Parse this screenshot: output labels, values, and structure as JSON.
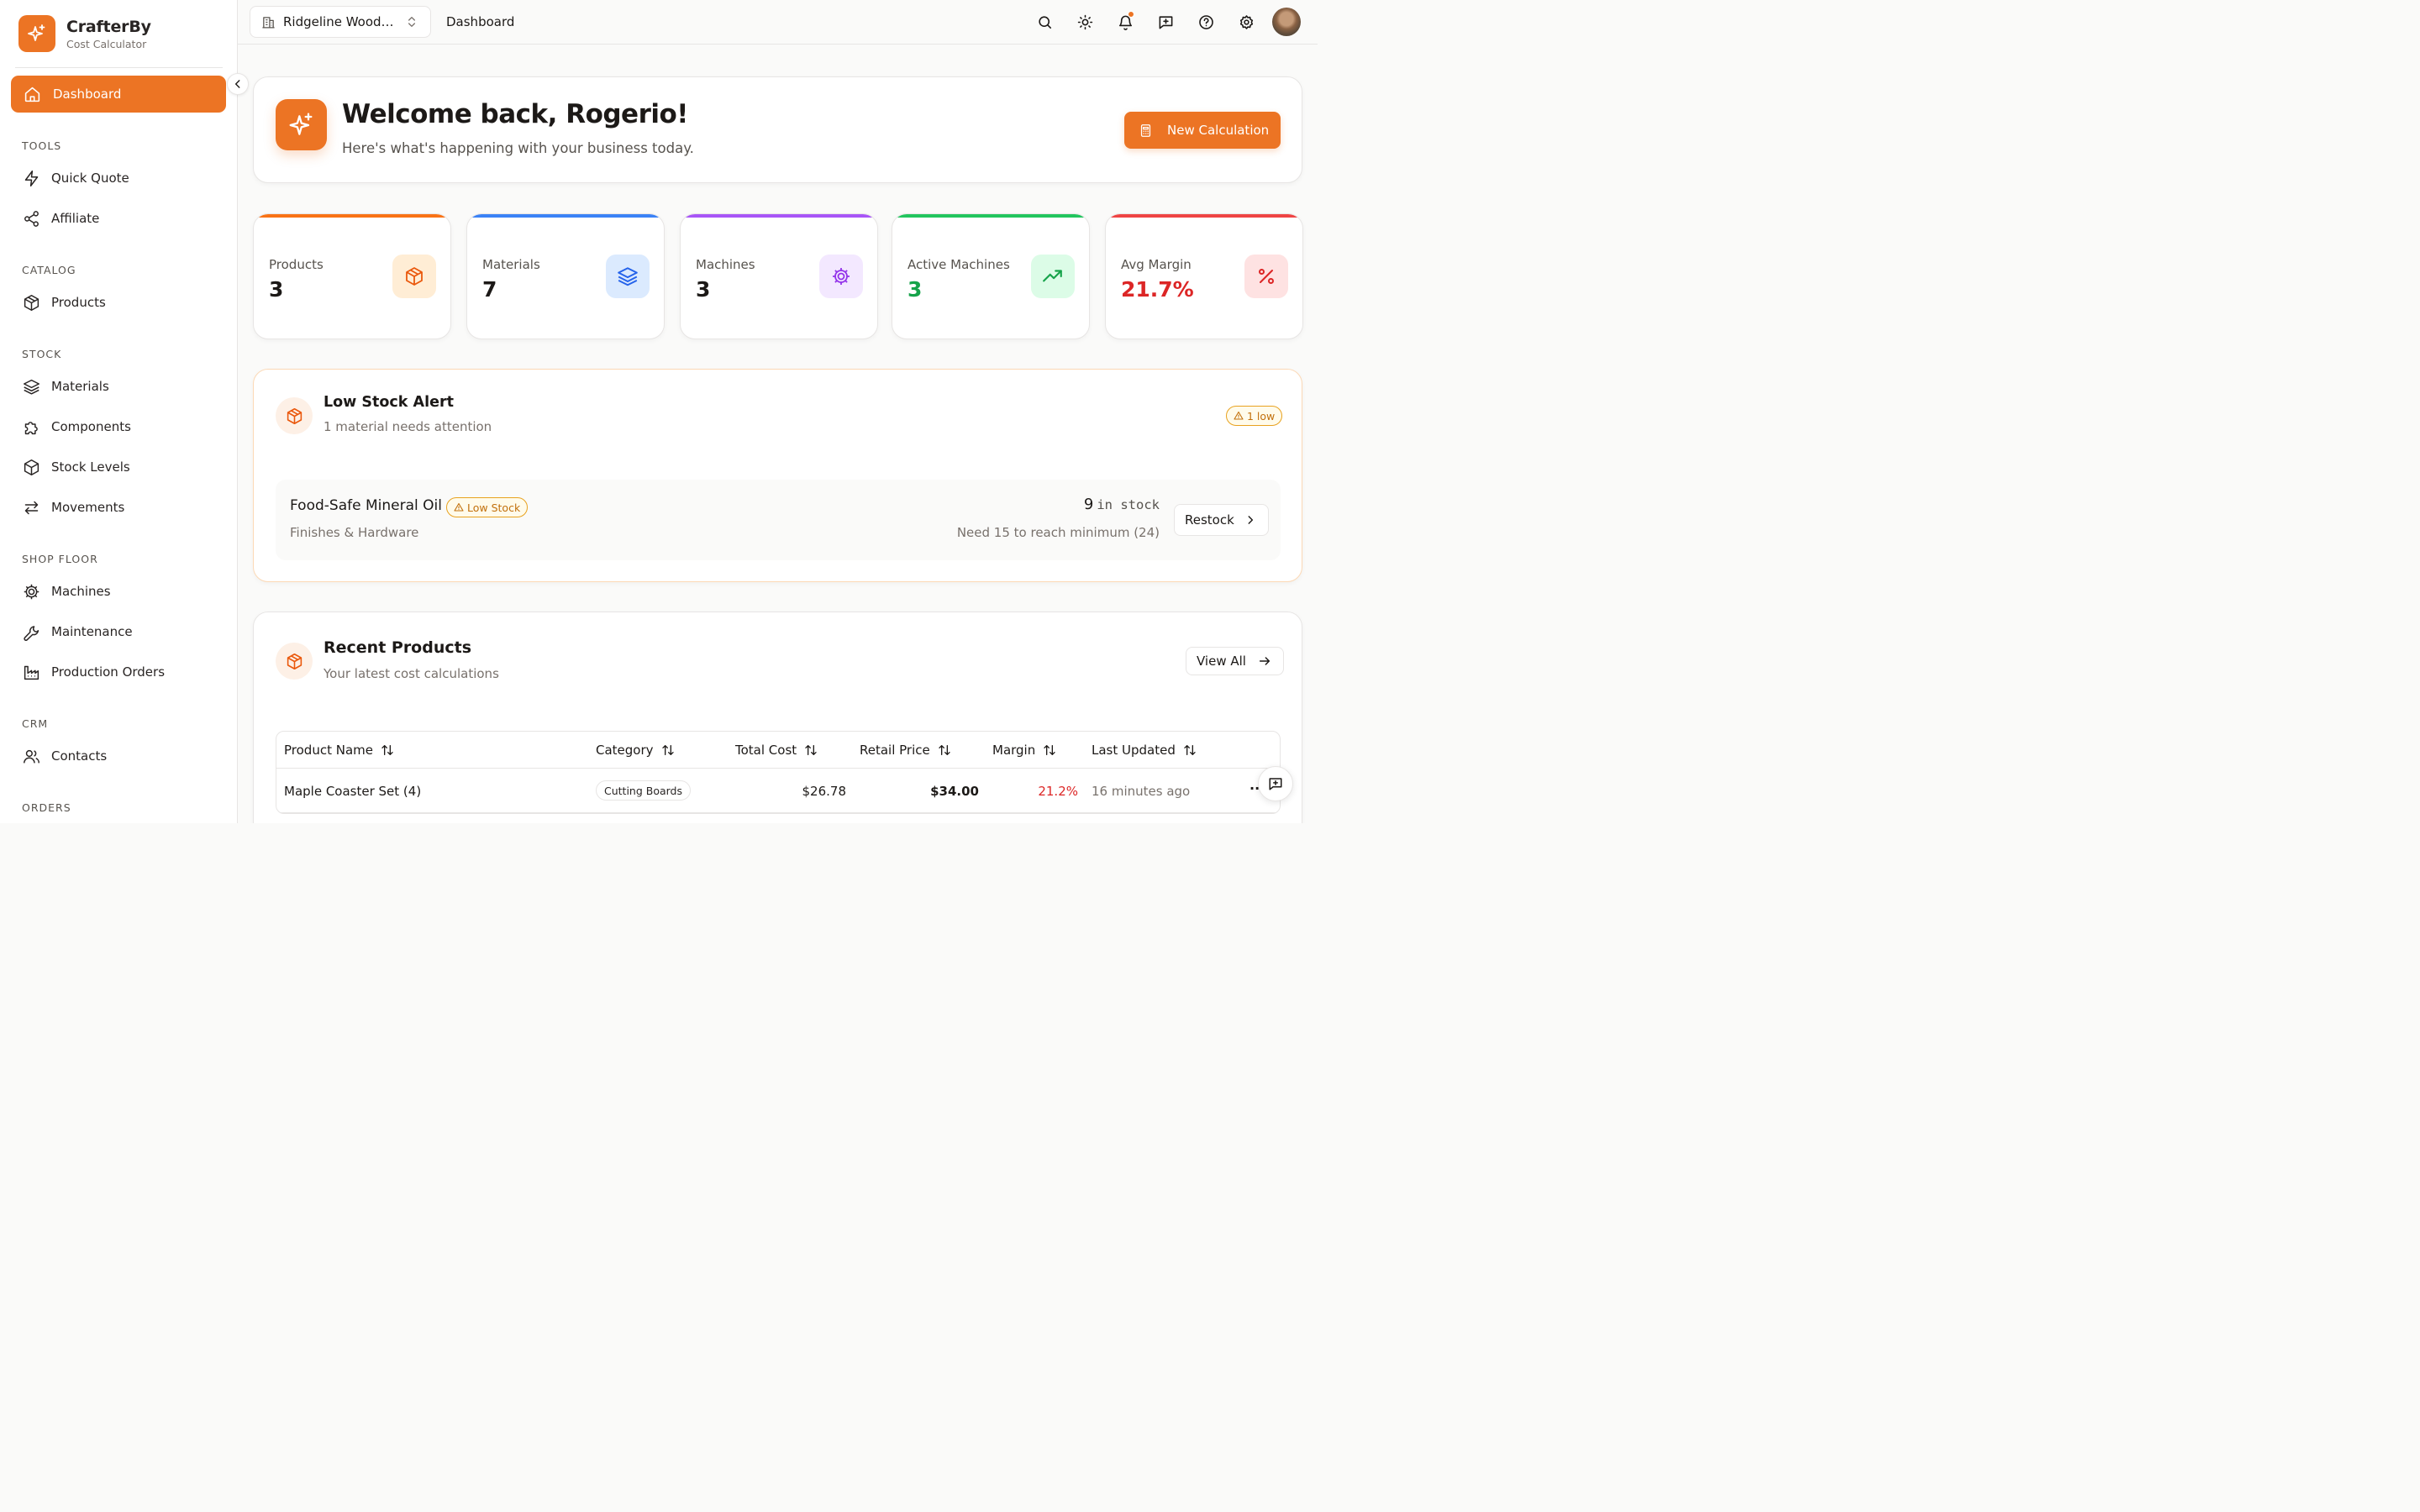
{
  "brand": {
    "name": "CrafterBy",
    "subtitle": "Cost Calculator",
    "accent": "#ec7424"
  },
  "sidebar": {
    "active": {
      "label": "Dashboard",
      "icon": "home-icon"
    },
    "sections": [
      {
        "title": "TOOLS",
        "items": [
          {
            "label": "Quick Quote",
            "icon": "bolt-icon"
          },
          {
            "label": "Affiliate",
            "icon": "share-icon"
          }
        ]
      },
      {
        "title": "CATALOG",
        "items": [
          {
            "label": "Products",
            "icon": "box-icon"
          }
        ]
      },
      {
        "title": "STOCK",
        "items": [
          {
            "label": "Materials",
            "icon": "layers-icon"
          },
          {
            "label": "Components",
            "icon": "puzzle-icon"
          },
          {
            "label": "Stock Levels",
            "icon": "package-icon"
          },
          {
            "label": "Movements",
            "icon": "swap-icon"
          }
        ]
      },
      {
        "title": "SHOP FLOOR",
        "items": [
          {
            "label": "Machines",
            "icon": "cog-icon"
          },
          {
            "label": "Maintenance",
            "icon": "wrench-icon"
          },
          {
            "label": "Production Orders",
            "icon": "factory-icon"
          }
        ]
      },
      {
        "title": "CRM",
        "items": [
          {
            "label": "Contacts",
            "icon": "users-icon"
          }
        ]
      },
      {
        "title": "ORDERS",
        "items": []
      }
    ]
  },
  "topbar": {
    "org": "Ridgeline Wood…",
    "breadcrumb": "Dashboard"
  },
  "welcome": {
    "title": "Welcome back, Rogerio!",
    "subtitle": "Here's what's happening with your business today.",
    "button": "New Calculation"
  },
  "stats": [
    {
      "label": "Products",
      "value": "3",
      "color": "#f97316",
      "value_color": "#1c1917",
      "icon": "box-icon"
    },
    {
      "label": "Materials",
      "value": "7",
      "color": "#3b82f6",
      "value_color": "#1c1917",
      "icon": "layers-icon"
    },
    {
      "label": "Machines",
      "value": "3",
      "color": "#a855f7",
      "value_color": "#1c1917",
      "icon": "cog-icon"
    },
    {
      "label": "Active Machines",
      "value": "3",
      "color": "#22c55e",
      "value_color": "#16a34a",
      "icon": "trending-up-icon"
    },
    {
      "label": "Avg Margin",
      "value": "21.7%",
      "color": "#ef4444",
      "value_color": "#dc2626",
      "icon": "percent-icon"
    }
  ],
  "low_stock": {
    "title": "Low Stock Alert",
    "subtitle": "1 material needs attention",
    "badge": "1 low",
    "item": {
      "name": "Food-Safe Mineral Oil",
      "badge": "Low Stock",
      "category": "Finishes & Hardware",
      "count": "9",
      "count_suffix": "in stock",
      "need": "Need 15 to reach minimum (24)",
      "action": "Restock"
    }
  },
  "recent": {
    "title": "Recent Products",
    "subtitle": "Your latest cost calculations",
    "view_all": "View All",
    "columns": [
      "Product Name",
      "Category",
      "Total Cost",
      "Retail Price",
      "Margin",
      "Last Updated"
    ],
    "rows": [
      {
        "name": "Maple Coaster Set (4)",
        "category": "Cutting Boards",
        "total_cost": "$26.78",
        "retail_price": "$34.00",
        "margin": "21.2%",
        "updated": "16 minutes ago"
      }
    ]
  }
}
